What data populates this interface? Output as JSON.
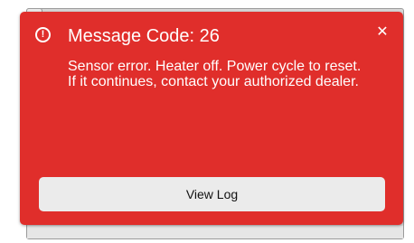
{
  "dialog": {
    "icon": "alert-circle-icon",
    "icon_glyph": "!",
    "title": "Message Code: 26",
    "message": "Sensor error. Heater off. Power cycle to reset. If it continues, contact your authorized dealer.",
    "close_glyph": "✕",
    "view_log_label": "View Log"
  },
  "colors": {
    "dialog_background": "#e02e2b",
    "button_background": "#ebebeb",
    "text_on_dialog": "#ffffff"
  }
}
